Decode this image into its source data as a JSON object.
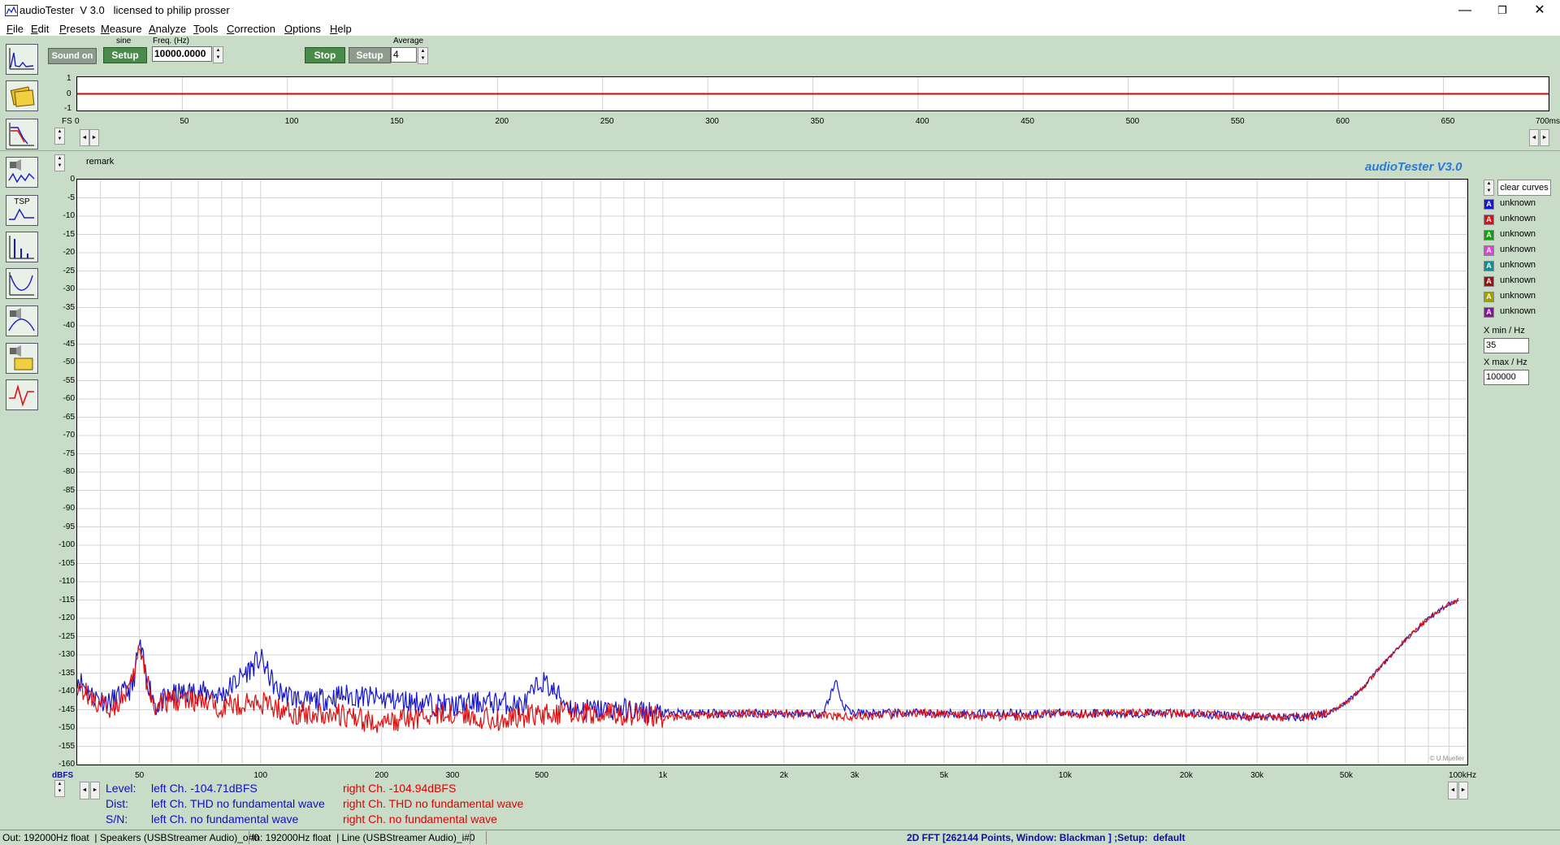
{
  "window": {
    "title": "audioTester  V 3.0   licensed to philip prosser",
    "minimize_glyph": "—",
    "restore_glyph": "❐",
    "close_glyph": "✕"
  },
  "menu": [
    {
      "key": "F",
      "rest": "ile"
    },
    {
      "key": "E",
      "rest": "dit"
    },
    {
      "key": "P",
      "rest": "resets"
    },
    {
      "key": "M",
      "rest": "easure"
    },
    {
      "key": "A",
      "rest": "nalyze"
    },
    {
      "key": "T",
      "rest": "ools"
    },
    {
      "key": "C",
      "rest": "orrection"
    },
    {
      "key": "O",
      "rest": "ptions"
    },
    {
      "key": "H",
      "rest": "elp"
    }
  ],
  "toolbar": {
    "sound_on_label": "Sound on",
    "sine_label": "sine",
    "setup1_label": "Setup",
    "freq_label": "Freq. (Hz)",
    "freq_value": "10000.0000",
    "stop_label": "Stop",
    "setup2_label": "Setup",
    "average_label": "Average",
    "average_value": "4"
  },
  "side_icons": [
    {
      "name": "fft-spectrum-icon",
      "label": ""
    },
    {
      "name": "folders-icon",
      "label": ""
    },
    {
      "name": "frequency-response-icon",
      "label": ""
    },
    {
      "name": "speaker-waveform-icon",
      "label": ""
    },
    {
      "name": "tsp-icon",
      "label": "TSP"
    },
    {
      "name": "distortion-icon",
      "label": ""
    },
    {
      "name": "impedance-icon",
      "label": ""
    },
    {
      "name": "speaker-filter-icon",
      "label": ""
    },
    {
      "name": "speaker-folder-icon",
      "label": ""
    },
    {
      "name": "step-response-icon",
      "label": ""
    }
  ],
  "osc": {
    "y_ticks": [
      "1",
      "0",
      "-1"
    ],
    "x_prefix": "FS",
    "x_ticks": [
      "0",
      "50",
      "100",
      "150",
      "200",
      "250",
      "300",
      "350",
      "400",
      "450",
      "500",
      "550",
      "600",
      "650",
      "700ms"
    ]
  },
  "main": {
    "remark": "remark",
    "brand": "audioTester  V3.0",
    "copyright": "© U.Mueller",
    "y_unit": "dBFS",
    "x_unit": "100kHz",
    "clear_curves_label": "clear curves",
    "curves": [
      {
        "label": "unknown",
        "color": "#1818d0"
      },
      {
        "label": "unknown",
        "color": "#e01010"
      },
      {
        "label": "unknown",
        "color": "#10a010"
      },
      {
        "label": "unknown",
        "color": "#e040e0"
      },
      {
        "label": "unknown",
        "color": "#109090"
      },
      {
        "label": "unknown",
        "color": "#a01010"
      },
      {
        "label": "unknown",
        "color": "#a0a000"
      },
      {
        "label": "unknown",
        "color": "#9010a0"
      }
    ],
    "xmin_label": "X min / Hz",
    "xmin_value": "35",
    "xmax_label": "X max / Hz",
    "xmax_value": "100000"
  },
  "readouts": {
    "level_label": "Level:",
    "dist_label": "Dist:",
    "sn_label": "S/N:",
    "level_left": "left Ch. -104.71dBFS",
    "level_right": "right Ch. -104.94dBFS",
    "dist_left": "left Ch. THD no fundamental wave",
    "dist_right": "right Ch. THD no fundamental wave",
    "sn_left": "left Ch.  no fundamental wave",
    "sn_right": "right Ch.  no fundamental wave"
  },
  "status": {
    "out": "Out: 192000Hz float  | Speakers (USBStreamer Audio)_o#0",
    "in": "In: 192000Hz float  | Line (USBStreamer Audio)_i#0",
    "mode": "2D FFT [262144 Points, Window: Blackman ] ;Setup:  default"
  },
  "chart_data": {
    "type": "line",
    "xscale": "log",
    "xlim": [
      35,
      100000
    ],
    "ylim": [
      -160,
      0
    ],
    "xlabel": "",
    "ylabel": "dBFS",
    "x_ticks": [
      "50",
      "100",
      "200",
      "300",
      "500",
      "1k",
      "2k",
      "3k",
      "5k",
      "10k",
      "20k",
      "30k",
      "50k",
      "100kHz"
    ],
    "y_ticks": [
      0,
      -5,
      -10,
      -15,
      -20,
      -25,
      -30,
      -35,
      -40,
      -45,
      -50,
      -55,
      -60,
      -65,
      -70,
      -75,
      -80,
      -85,
      -90,
      -95,
      -100,
      -105,
      -110,
      -115,
      -120,
      -125,
      -130,
      -135,
      -140,
      -145,
      -150,
      -155,
      -160
    ],
    "grid": true,
    "series": [
      {
        "color": "#1818c8",
        "x": [
          35,
          38,
          42,
          45,
          48,
          50,
          52,
          55,
          60,
          70,
          80,
          100,
          110,
          130,
          160,
          200,
          250,
          300,
          350,
          400,
          450,
          500,
          600,
          800,
          1000,
          1500,
          2000,
          2500,
          2700,
          2800,
          3000,
          3500,
          4000,
          5000,
          7000,
          10000,
          15000,
          20000,
          30000,
          40000,
          45000,
          50000,
          55000,
          60000,
          70000,
          80000,
          90000,
          95000
        ],
        "y": [
          -136,
          -141,
          -143,
          -141,
          -139,
          -127,
          -136,
          -144,
          -141,
          -140,
          -141,
          -131,
          -140,
          -143,
          -141,
          -142,
          -143,
          -144,
          -143,
          -143,
          -144,
          -137,
          -145,
          -145,
          -146,
          -146,
          -146,
          -146,
          -137,
          -144,
          -146,
          -146,
          -146,
          -146,
          -146,
          -146,
          -146,
          -146,
          -147,
          -147,
          -146,
          -143,
          -139,
          -134,
          -126,
          -120,
          -116,
          -115
        ]
      },
      {
        "color": "#e01010",
        "x": [
          35,
          38,
          42,
          45,
          48,
          50,
          52,
          55,
          60,
          70,
          80,
          100,
          120,
          150,
          180,
          200,
          250,
          300,
          350,
          400,
          500,
          600,
          800,
          1000,
          1500,
          2000,
          3000,
          4000,
          5000,
          7000,
          10000,
          15000,
          20000,
          30000,
          40000,
          45000,
          50000,
          55000,
          60000,
          70000,
          80000,
          90000,
          95000
        ],
        "y": [
          -138,
          -142,
          -145,
          -142,
          -138,
          -128,
          -137,
          -145,
          -142,
          -143,
          -144,
          -143,
          -146,
          -146,
          -148,
          -149,
          -147,
          -146,
          -147,
          -148,
          -146,
          -146,
          -146,
          -147,
          -146,
          -146,
          -147,
          -146,
          -146,
          -147,
          -146,
          -146,
          -146,
          -147,
          -147,
          -146,
          -143,
          -139,
          -134,
          -126,
          -120,
          -116,
          -115
        ]
      }
    ]
  }
}
